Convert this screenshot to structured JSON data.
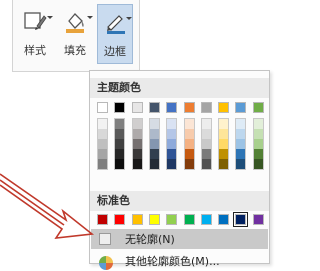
{
  "ribbon": {
    "buttons": [
      {
        "label": "样式",
        "icon": "shape-style-icon",
        "active": false
      },
      {
        "label": "填充",
        "icon": "paint-bucket-icon",
        "active": false
      },
      {
        "label": "边框",
        "icon": "pen-outline-icon",
        "active": true
      }
    ]
  },
  "menu": {
    "theme_header": "主题颜色",
    "theme_colors": [
      "#ffffff",
      "#000000",
      "#e7e6e6",
      "#44546a",
      "#4472c4",
      "#ed7d31",
      "#a5a5a5",
      "#ffc000",
      "#5b9bd5",
      "#70ad47"
    ],
    "theme_shades": [
      [
        "#f2f2f2",
        "#d8d8d8",
        "#bfbfbf",
        "#a5a5a5",
        "#7f7f7f"
      ],
      [
        "#7f7f7f",
        "#595959",
        "#404040",
        "#262626",
        "#0d0d0d"
      ],
      [
        "#d0cece",
        "#aeaaaa",
        "#757070",
        "#3a3838",
        "#171616"
      ],
      [
        "#d6dce4",
        "#adb9ca",
        "#8496b0",
        "#323f4f",
        "#222a35"
      ],
      [
        "#d9e2f3",
        "#b4c6e7",
        "#8eaadb",
        "#2f5496",
        "#1f3864"
      ],
      [
        "#fbe5d5",
        "#f7cbac",
        "#f4b183",
        "#c55a11",
        "#843c0b"
      ],
      [
        "#ededed",
        "#dbdbdb",
        "#c9c9c9",
        "#7b7b7b",
        "#525252"
      ],
      [
        "#fff2cc",
        "#fee599",
        "#ffd965",
        "#bf9000",
        "#7f6000"
      ],
      [
        "#deebf6",
        "#bdd7ee",
        "#9cc3e5",
        "#2e75b5",
        "#1e4e79"
      ],
      [
        "#e2efd9",
        "#c5e0b3",
        "#a8d08d",
        "#538135",
        "#375623"
      ]
    ],
    "standard_header": "标准色",
    "standard_colors": [
      "#c00000",
      "#ff0000",
      "#ffc000",
      "#ffff00",
      "#92d050",
      "#00b050",
      "#00b0f0",
      "#0070c0",
      "#002060",
      "#7030a0"
    ],
    "standard_selected_index": 8,
    "no_outline_label": "无轮廓(N)",
    "more_colors_label": "其他轮廓颜色(M)..."
  },
  "annotation": {
    "arrow_color": "#c0392b"
  }
}
